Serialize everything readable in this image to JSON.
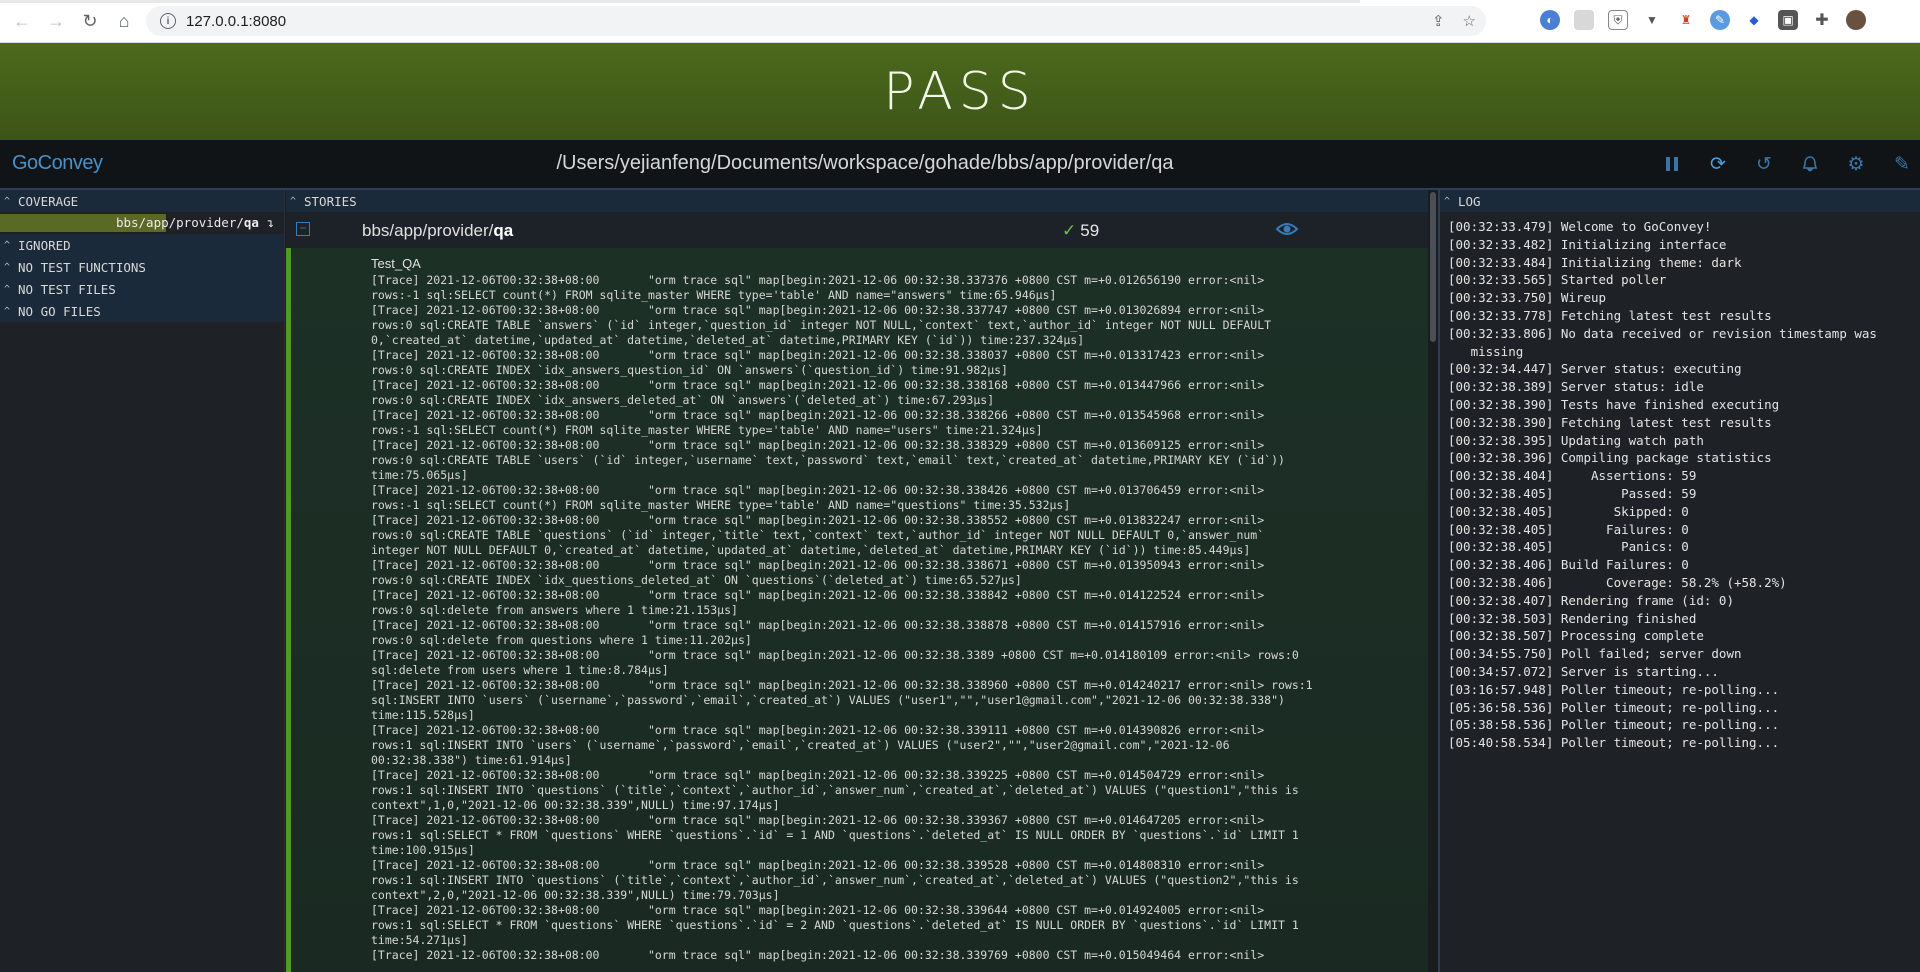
{
  "browser": {
    "url": "127.0.0.1:8080"
  },
  "banner": {
    "status": "PASS"
  },
  "header": {
    "brand": "GoConvey",
    "path": "/Users/yejianfeng/Documents/workspace/gohade/bbs/app/provider/qa"
  },
  "left": {
    "coverage_title": "COVERAGE",
    "coverage_pkg_prefix": "bbs/app/provider/",
    "coverage_pkg_bold": "qa",
    "coverage_percent": 58.2,
    "ignored": "IGNORED",
    "no_test_functions": "NO TEST FUNCTIONS",
    "no_test_files": "NO TEST FILES",
    "no_go_files": "NO GO FILES"
  },
  "stories": {
    "title": "STORIES",
    "pkg_prefix": "bbs/app/provider/",
    "pkg_bold": "qa",
    "passed_count": "59",
    "test_name": "Test_QA",
    "trace": "[Trace] 2021-12-06T00:32:38+08:00       \"orm trace sql\" map[begin:2021-12-06 00:32:38.337376 +0800 CST m=+0.012656190 error:<nil>\nrows:-1 sql:SELECT count(*) FROM sqlite_master WHERE type='table' AND name=\"answers\" time:65.946µs]\n[Trace] 2021-12-06T00:32:38+08:00       \"orm trace sql\" map[begin:2021-12-06 00:32:38.337747 +0800 CST m=+0.013026894 error:<nil>\nrows:0 sql:CREATE TABLE `answers` (`id` integer,`question_id` integer NOT NULL,`context` text,`author_id` integer NOT NULL DEFAULT\n0,`created_at` datetime,`updated_at` datetime,`deleted_at` datetime,PRIMARY KEY (`id`)) time:237.324µs]\n[Trace] 2021-12-06T00:32:38+08:00       \"orm trace sql\" map[begin:2021-12-06 00:32:38.338037 +0800 CST m=+0.013317423 error:<nil>\nrows:0 sql:CREATE INDEX `idx_answers_question_id` ON `answers`(`question_id`) time:91.982µs]\n[Trace] 2021-12-06T00:32:38+08:00       \"orm trace sql\" map[begin:2021-12-06 00:32:38.338168 +0800 CST m=+0.013447966 error:<nil>\nrows:0 sql:CREATE INDEX `idx_answers_deleted_at` ON `answers`(`deleted_at`) time:67.293µs]\n[Trace] 2021-12-06T00:32:38+08:00       \"orm trace sql\" map[begin:2021-12-06 00:32:38.338266 +0800 CST m=+0.013545968 error:<nil>\nrows:-1 sql:SELECT count(*) FROM sqlite_master WHERE type='table' AND name=\"users\" time:21.324µs]\n[Trace] 2021-12-06T00:32:38+08:00       \"orm trace sql\" map[begin:2021-12-06 00:32:38.338329 +0800 CST m=+0.013609125 error:<nil>\nrows:0 sql:CREATE TABLE `users` (`id` integer,`username` text,`password` text,`email` text,`created_at` datetime,PRIMARY KEY (`id`))\ntime:75.065µs]\n[Trace] 2021-12-06T00:32:38+08:00       \"orm trace sql\" map[begin:2021-12-06 00:32:38.338426 +0800 CST m=+0.013706459 error:<nil>\nrows:-1 sql:SELECT count(*) FROM sqlite_master WHERE type='table' AND name=\"questions\" time:35.532µs]\n[Trace] 2021-12-06T00:32:38+08:00       \"orm trace sql\" map[begin:2021-12-06 00:32:38.338552 +0800 CST m=+0.013832247 error:<nil>\nrows:0 sql:CREATE TABLE `questions` (`id` integer,`title` text,`context` text,`author_id` integer NOT NULL DEFAULT 0,`answer_num`\ninteger NOT NULL DEFAULT 0,`created_at` datetime,`updated_at` datetime,`deleted_at` datetime,PRIMARY KEY (`id`)) time:85.449µs]\n[Trace] 2021-12-06T00:32:38+08:00       \"orm trace sql\" map[begin:2021-12-06 00:32:38.338671 +0800 CST m=+0.013950943 error:<nil>\nrows:0 sql:CREATE INDEX `idx_questions_deleted_at` ON `questions`(`deleted_at`) time:65.527µs]\n[Trace] 2021-12-06T00:32:38+08:00       \"orm trace sql\" map[begin:2021-12-06 00:32:38.338842 +0800 CST m=+0.014122524 error:<nil>\nrows:0 sql:delete from answers where 1 time:21.153µs]\n[Trace] 2021-12-06T00:32:38+08:00       \"orm trace sql\" map[begin:2021-12-06 00:32:38.338878 +0800 CST m=+0.014157916 error:<nil>\nrows:0 sql:delete from questions where 1 time:11.202µs]\n[Trace] 2021-12-06T00:32:38+08:00       \"orm trace sql\" map[begin:2021-12-06 00:32:38.3389 +0800 CST m=+0.014180109 error:<nil> rows:0\nsql:delete from users where 1 time:8.784µs]\n[Trace] 2021-12-06T00:32:38+08:00       \"orm trace sql\" map[begin:2021-12-06 00:32:38.338960 +0800 CST m=+0.014240217 error:<nil> rows:1\nsql:INSERT INTO `users` (`username`,`password`,`email`,`created_at`) VALUES (\"user1\",\"\",\"user1@gmail.com\",\"2021-12-06 00:32:38.338\")\ntime:115.528µs]\n[Trace] 2021-12-06T00:32:38+08:00       \"orm trace sql\" map[begin:2021-12-06 00:32:38.339111 +0800 CST m=+0.014390826 error:<nil>\nrows:1 sql:INSERT INTO `users` (`username`,`password`,`email`,`created_at`) VALUES (\"user2\",\"\",\"user2@gmail.com\",\"2021-12-06\n00:32:38.338\") time:61.914µs]\n[Trace] 2021-12-06T00:32:38+08:00       \"orm trace sql\" map[begin:2021-12-06 00:32:38.339225 +0800 CST m=+0.014504729 error:<nil>\nrows:1 sql:INSERT INTO `questions` (`title`,`context`,`author_id`,`answer_num`,`created_at`,`deleted_at`) VALUES (\"question1\",\"this is\ncontext\",1,0,\"2021-12-06 00:32:38.339\",NULL) time:97.174µs]\n[Trace] 2021-12-06T00:32:38+08:00       \"orm trace sql\" map[begin:2021-12-06 00:32:38.339367 +0800 CST m=+0.014647205 error:<nil>\nrows:1 sql:SELECT * FROM `questions` WHERE `questions`.`id` = 1 AND `questions`.`deleted_at` IS NULL ORDER BY `questions`.`id` LIMIT 1\ntime:100.915µs]\n[Trace] 2021-12-06T00:32:38+08:00       \"orm trace sql\" map[begin:2021-12-06 00:32:38.339528 +0800 CST m=+0.014808310 error:<nil>\nrows:1 sql:INSERT INTO `questions` (`title`,`context`,`author_id`,`answer_num`,`created_at`,`deleted_at`) VALUES (\"question2\",\"this is\ncontext\",2,0,\"2021-12-06 00:32:38.339\",NULL) time:79.703µs]\n[Trace] 2021-12-06T00:32:38+08:00       \"orm trace sql\" map[begin:2021-12-06 00:32:38.339644 +0800 CST m=+0.014924005 error:<nil>\nrows:1 sql:SELECT * FROM `questions` WHERE `questions`.`id` = 2 AND `questions`.`deleted_at` IS NULL ORDER BY `questions`.`id` LIMIT 1\ntime:54.271µs]\n[Trace] 2021-12-06T00:32:38+08:00       \"orm trace sql\" map[begin:2021-12-06 00:32:38.339769 +0800 CST m=+0.015049464 error:<nil>"
  },
  "log": {
    "title": "LOG",
    "lines": [
      "[00:32:33.479] Welcome to GoConvey!",
      "[00:32:33.482] Initializing interface",
      "[00:32:33.484] Initializing theme: dark",
      "[00:32:33.565] Started poller",
      "[00:32:33.750] Wireup",
      "[00:32:33.778] Fetching latest test results",
      "[00:32:33.806] No data received or revision timestamp was\n   missing",
      "[00:32:34.447] Server status: executing",
      "[00:32:38.389] Server status: idle",
      "[00:32:38.390] Tests have finished executing",
      "[00:32:38.390] Fetching latest test results",
      "[00:32:38.395] Updating watch path",
      "[00:32:38.396] Compiling package statistics",
      "[00:32:38.404]     Assertions: 59",
      "[00:32:38.405]         Passed: 59",
      "[00:32:38.405]        Skipped: 0",
      "[00:32:38.405]       Failures: 0",
      "[00:32:38.405]         Panics: 0",
      "[00:32:38.406] Build Failures: 0",
      "[00:32:38.406]       Coverage: 58.2% (+58.2%)",
      "[00:32:38.407] Rendering frame (id: 0)",
      "[00:32:38.503] Rendering finished",
      "[00:32:38.507] Processing complete",
      "[00:34:55.750] Poll failed; server down",
      "[00:34:57.072] Server is starting...",
      "[03:16:57.948] Poller timeout; re-polling...",
      "[05:36:58.536] Poller timeout; re-polling...",
      "[05:38:58.536] Poller timeout; re-polling...",
      "[05:40:58.534] Poller timeout; re-polling..."
    ]
  },
  "colors": {
    "pass_banner": "#3f5a18",
    "accent_blue": "#3d74a6",
    "pass_green": "#4f9a2a"
  }
}
